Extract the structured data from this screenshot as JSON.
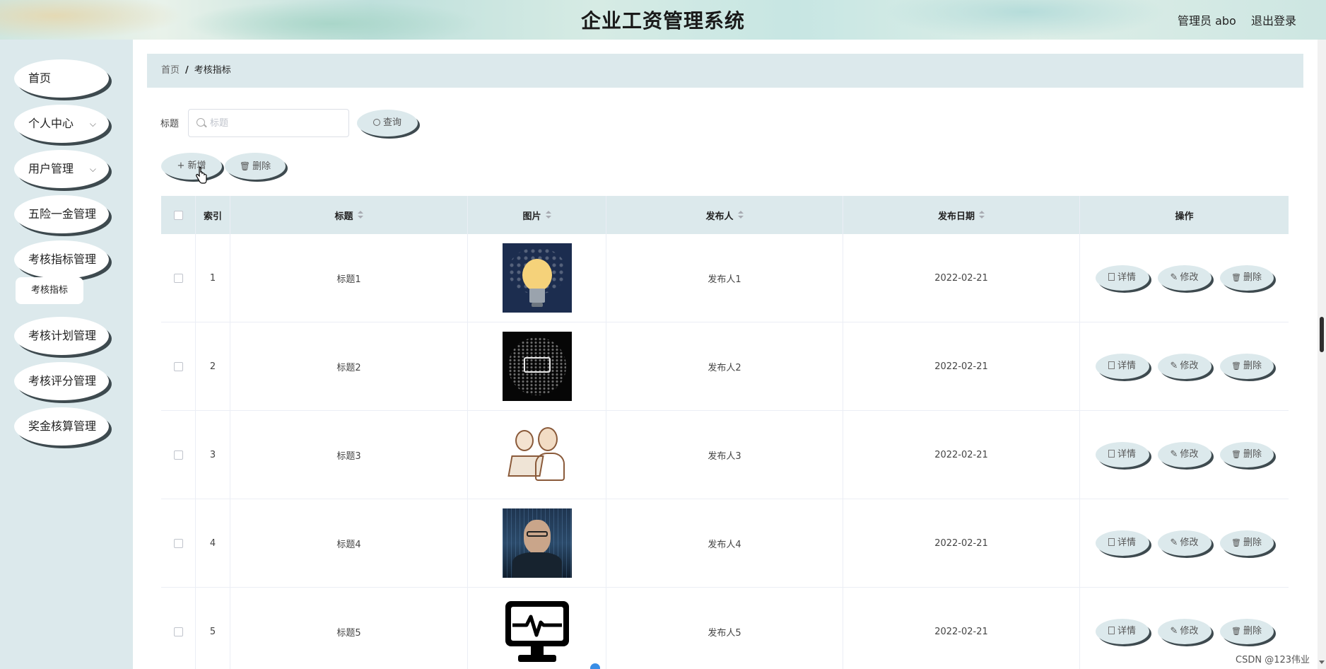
{
  "header": {
    "title": "企业工资管理系统",
    "admin_label": "管理员 abo",
    "logout_label": "退出登录"
  },
  "sidebar": {
    "items": [
      {
        "label": "首页",
        "has_chevron": false
      },
      {
        "label": "个人中心",
        "has_chevron": true
      },
      {
        "label": "用户管理",
        "has_chevron": true
      },
      {
        "label": "五险一金管理",
        "has_chevron": false
      },
      {
        "label": "考核指标管理",
        "has_chevron": false
      },
      {
        "label": "考核计划管理",
        "has_chevron": false
      },
      {
        "label": "考核评分管理",
        "has_chevron": false
      },
      {
        "label": "奖金核算管理",
        "has_chevron": false
      }
    ],
    "active_sub_item": "考核指标",
    "chevron_glyph": "⌵"
  },
  "breadcrumb": {
    "home": "首页",
    "separator": "/",
    "current": "考核指标"
  },
  "search": {
    "label": "标题",
    "placeholder": "标题",
    "value": "",
    "button_label": "查询"
  },
  "toolbar": {
    "add_label": "+ 新增",
    "delete_label": "删除"
  },
  "table": {
    "columns": [
      {
        "key": "select",
        "label": ""
      },
      {
        "key": "index",
        "label": "索引"
      },
      {
        "key": "title",
        "label": "标题",
        "sortable": true
      },
      {
        "key": "image",
        "label": "图片",
        "sortable": true
      },
      {
        "key": "publisher",
        "label": "发布人",
        "sortable": true
      },
      {
        "key": "date",
        "label": "发布日期",
        "sortable": true
      },
      {
        "key": "actions",
        "label": "操作"
      }
    ],
    "rows": [
      {
        "index": "1",
        "title": "标题1",
        "image": "lightbulb-image",
        "publisher": "发布人1",
        "date": "2022-02-21"
      },
      {
        "index": "2",
        "title": "标题2",
        "image": "programming-words-image",
        "publisher": "发布人2",
        "date": "2022-02-21"
      },
      {
        "index": "3",
        "title": "标题3",
        "image": "programmers-sketch-image",
        "publisher": "发布人3",
        "date": "2022-02-21"
      },
      {
        "index": "4",
        "title": "标题4",
        "image": "hacker-portrait-image",
        "publisher": "发布人4",
        "date": "2022-02-21"
      },
      {
        "index": "5",
        "title": "标题5",
        "image": "monitor-pulse-image",
        "publisher": "发布人5",
        "date": "2022-02-21"
      }
    ],
    "row_actions": {
      "detail": "详情",
      "edit": "修改",
      "delete": "删除"
    }
  },
  "watermark": "CSDN @123伟业",
  "colors": {
    "panel_bg": "#dce9ec",
    "pill_shadow": "#3e4a4f",
    "header_tint": "#c7e6e3"
  }
}
